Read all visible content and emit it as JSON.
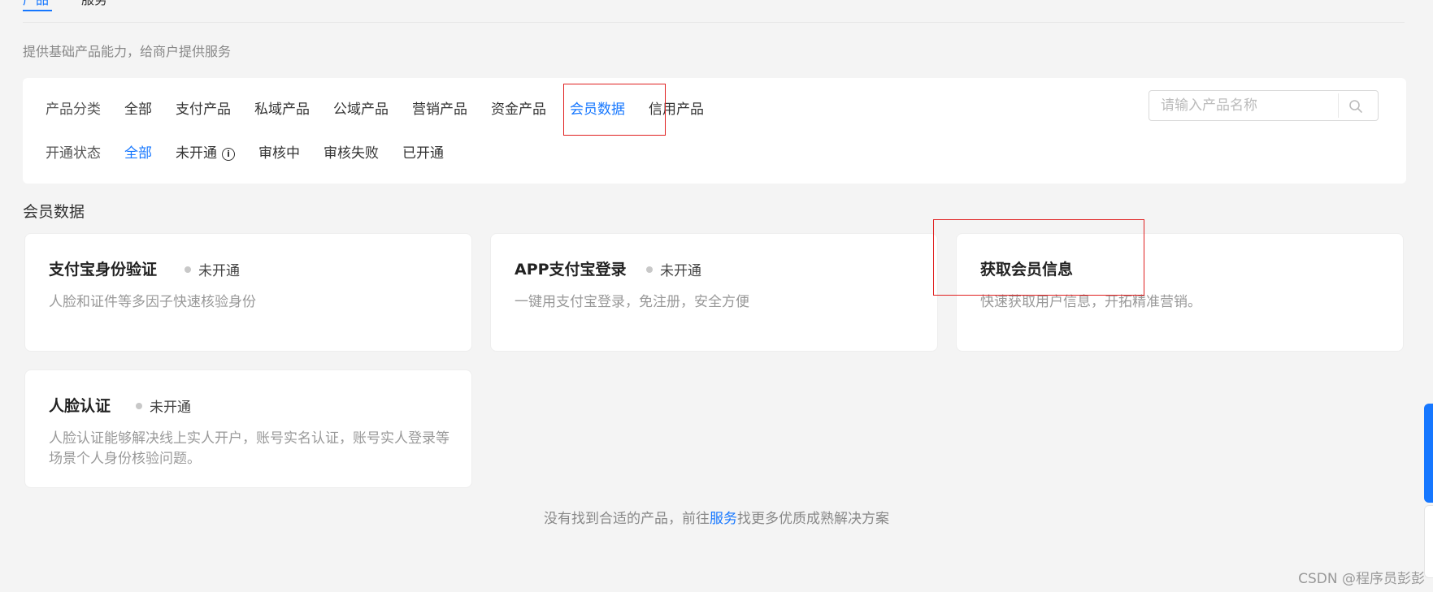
{
  "top_tabs": [
    {
      "label": "产品",
      "active": true
    },
    {
      "label": "服务",
      "active": false
    }
  ],
  "intro": "提供基础产品能力，给商户提供服务",
  "filters": {
    "category": {
      "label": "产品分类",
      "options": [
        "全部",
        "支付产品",
        "私域产品",
        "公域产品",
        "营销产品",
        "资金产品",
        "会员数据",
        "信用产品"
      ],
      "selected": "会员数据"
    },
    "status": {
      "label": "开通状态",
      "options": [
        "全部",
        "未开通",
        "审核中",
        "审核失败",
        "已开通"
      ],
      "selected": "全部"
    }
  },
  "search": {
    "placeholder": "请输入产品名称",
    "value": "",
    "icon": "search-icon"
  },
  "section_title": "会员数据",
  "cards": [
    {
      "title": "支付宝身份验证",
      "status": "未开通",
      "desc": "人脸和证件等多因子快速核验身份"
    },
    {
      "title": "APP支付宝登录",
      "status": "未开通",
      "desc": "一键用支付宝登录，免注册，安全方便"
    },
    {
      "title": "获取会员信息",
      "status": "",
      "desc": "快速获取用户信息，开拓精准营销。"
    },
    {
      "title": "人脸认证",
      "status": "未开通",
      "desc": "人脸认证能够解决线上实人开户，账号实名认证，账号实人登录等场景个人身份核验问题。"
    }
  ],
  "footer": {
    "before": "没有找到合适的产品，前往",
    "link": "服务",
    "after": "找更多优质成熟解决方案"
  },
  "watermark": "CSDN @程序员彭彭",
  "colors": {
    "accent": "#1677ff",
    "highlight": "#e02020",
    "background": "#f4f4f4"
  }
}
